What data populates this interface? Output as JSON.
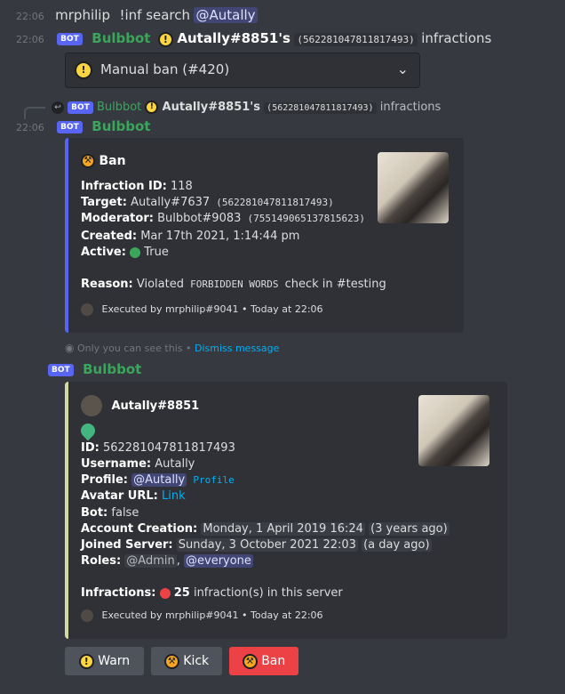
{
  "msg1": {
    "time": "22:06",
    "author": "mrphilip",
    "command": "!inf search",
    "mention": "@Autally"
  },
  "msg2": {
    "time": "22:06",
    "bot_tag": "BOT",
    "author": "Bulbbot",
    "user": "Autally#8851's",
    "id": "(562281047811817493)",
    "suffix": "infractions",
    "select_value": "Manual ban (#420)"
  },
  "reply": {
    "bot_tag": "BOT",
    "author": "Bulbbot",
    "user": "Autally#8851's",
    "id": "(562281047811817493)",
    "suffix": "infractions"
  },
  "msg3": {
    "time": "22:06",
    "bot_tag": "BOT",
    "author": "Bulbbot",
    "embed": {
      "title": "Ban",
      "fields": [
        {
          "label": "Infraction ID:",
          "value": "118"
        },
        {
          "label": "Target:",
          "value": "Autally#7637",
          "code": "(562281047811817493)"
        },
        {
          "label": "Moderator:",
          "value": "Bulbbot#9083",
          "code": "(755149065137815623)"
        },
        {
          "label": "Created:",
          "value": "Mar 17th 2021, 1:14:44 pm"
        },
        {
          "label": "Active:",
          "value": "True"
        }
      ],
      "reason_label": "Reason:",
      "reason_pre": "Violated",
      "reason_code": "FORBIDDEN WORDS",
      "reason_post": "check in #testing",
      "footer": "Executed by mrphilip#9041 • Today at 22:06"
    },
    "ephemeral": "Only you can see this •",
    "dismiss": "Dismiss message"
  },
  "msg4": {
    "bot_tag": "BOT",
    "author": "Bulbbot",
    "embed": {
      "author": "Autally#8851",
      "id_label": "ID:",
      "id_value": "562281047811817493",
      "username_label": "Username:",
      "username_value": "Autally",
      "profile_label": "Profile:",
      "profile_mention": "@Autally",
      "profile_code": "Profile",
      "avatar_label": "Avatar URL:",
      "avatar_link": "Link",
      "bot_label": "Bot:",
      "bot_value": "false",
      "creation_label": "Account Creation:",
      "creation_value": "Monday, 1 April 2019 16:24",
      "creation_rel": "(3 years ago)",
      "joined_label": "Joined Server:",
      "joined_value": "Sunday, 3 October 2021 22:03",
      "joined_rel": "(a day ago)",
      "roles_label": "Roles:",
      "role1": "@Admin",
      "role2": "@everyone",
      "inf_label": "Infractions:",
      "inf_count": "25",
      "inf_text": "infraction(s) in this server",
      "footer": "Executed by mrphilip#9041 • Today at 22:06"
    },
    "buttons": [
      {
        "label": "Warn",
        "color": "#4f545c"
      },
      {
        "label": "Kick",
        "color": "#4f545c"
      },
      {
        "label": "Ban",
        "color": "#ed4245"
      }
    ]
  }
}
